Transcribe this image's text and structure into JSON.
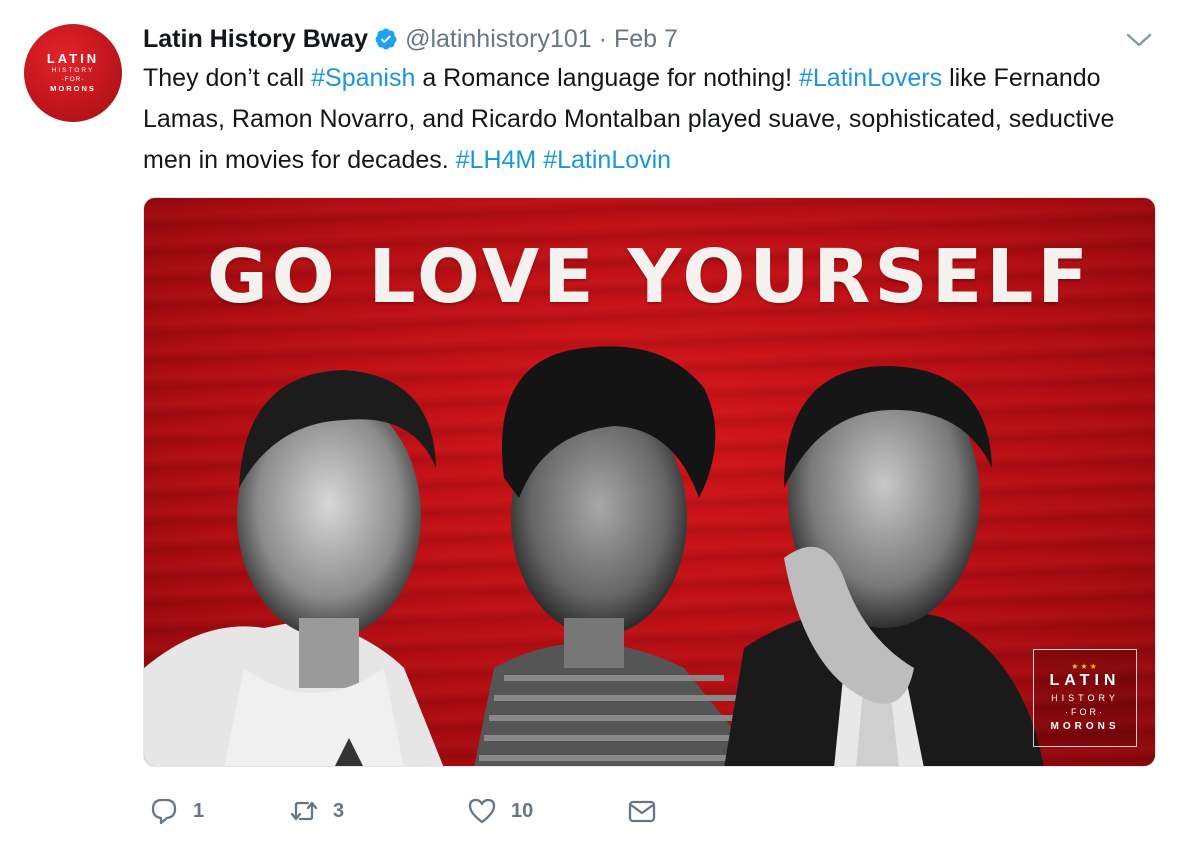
{
  "user": {
    "display_name": "Latin History Bway",
    "handle": "@latinhistory101",
    "separator": "·",
    "date": "Feb 7",
    "avatar_lines": [
      "LATIN",
      "HISTORY",
      "·FOR·",
      "MORONS"
    ]
  },
  "tweet": {
    "segments": [
      {
        "text": "They don’t call ",
        "type": "text"
      },
      {
        "text": "#Spanish",
        "type": "hashtag"
      },
      {
        "text": " a Romance language for nothing! ",
        "type": "text"
      },
      {
        "text": "#LatinLovers",
        "type": "hashtag"
      },
      {
        "text": " like Fernando Lamas, Ramon Novarro, and Ricardo Montalban played suave, sophisticated, seductive men in movies for decades. ",
        "type": "text"
      },
      {
        "text": "#LH4M",
        "type": "hashtag"
      },
      {
        "text": " ",
        "type": "text"
      },
      {
        "text": "#LatinLovin",
        "type": "hashtag"
      }
    ]
  },
  "media": {
    "headline": "GO LOVE YOURSELF",
    "logo": {
      "stars": "★★★",
      "lines": [
        "LATIN",
        "HISTORY",
        "·FOR·",
        "MORONS"
      ]
    }
  },
  "actions": {
    "reply_count": "1",
    "retweet_count": "3",
    "like_count": "10"
  },
  "colors": {
    "link": "#1b95e0",
    "muted": "#657786",
    "brand_red": "#c2161c"
  }
}
